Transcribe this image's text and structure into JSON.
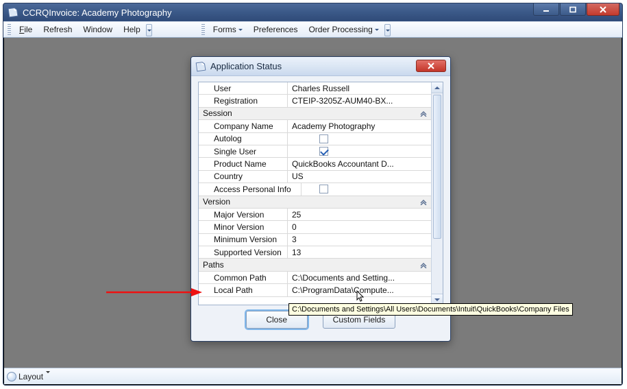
{
  "window": {
    "title": "CCRQInvoice: Academy Photography"
  },
  "menubar1": {
    "file": "File",
    "refresh": "Refresh",
    "window": "Window",
    "help": "Help"
  },
  "menubar2": {
    "forms": "Forms",
    "preferences": "Preferences",
    "order_processing": "Order Processing"
  },
  "dialog": {
    "title": "Application Status",
    "buttons": {
      "close": "Close",
      "custom": "Custom Fields"
    },
    "rows": {
      "user_label": "User",
      "user_value": "Charles Russell",
      "reg_label": "Registration",
      "reg_value": "CTEIP-3205Z-AUM40-BX...",
      "session": "Session",
      "company_label": "Company Name",
      "company_value": "Academy Photography",
      "autolog_label": "Autolog",
      "singleuser_label": "Single User",
      "product_label": "Product Name",
      "product_value": "QuickBooks Accountant D...",
      "country_label": "Country",
      "country_value": "US",
      "access_label": "Access Personal Info",
      "version": "Version",
      "major_label": "Major Version",
      "major_value": "25",
      "minor_label": "Minor Version",
      "minor_value": "0",
      "minimum_label": "Minimum Version",
      "minimum_value": "3",
      "supported_label": "Supported Version",
      "supported_value": "13",
      "paths": "Paths",
      "common_label": "Common Path",
      "common_value": "C:\\Documents and Setting...",
      "local_label": "Local Path",
      "local_value": "C:\\ProgramData\\Compute..."
    }
  },
  "tooltip": "C:\\Documents and Settings\\All Users\\Documents\\Intuit\\QuickBooks\\Company Files",
  "statusbar": {
    "layout": "Layout"
  }
}
